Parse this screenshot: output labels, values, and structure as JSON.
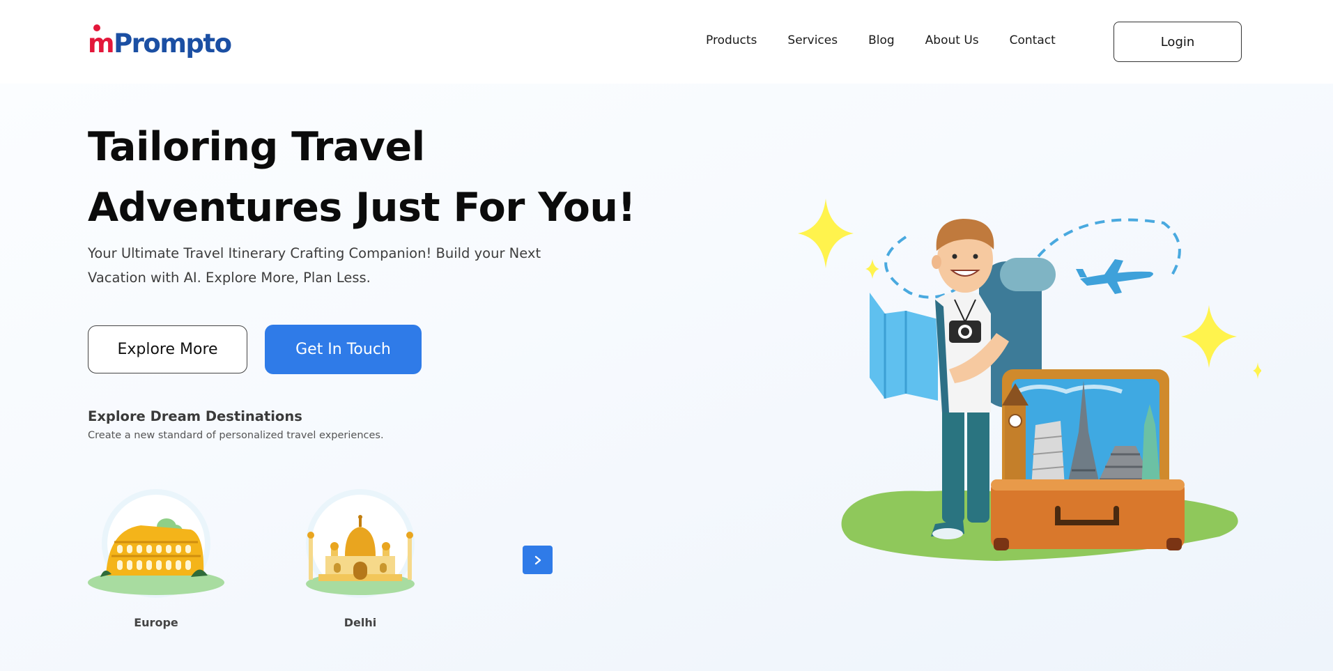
{
  "header": {
    "logo_m": "m",
    "logo_rest": "Prompto",
    "nav": [
      "Products",
      "Services",
      "Blog",
      "About Us",
      "Contact"
    ],
    "login_label": "Login"
  },
  "hero": {
    "title_line1": "Tailoring Travel",
    "title_line2": "Adventures Just For You!",
    "subtitle_line1": "Your Ultimate Travel Itinerary Crafting Companion! Build your Next",
    "subtitle_line2": "Vacation with AI. Explore More, Plan Less.",
    "explore_label": "Explore More",
    "touch_label": "Get In Touch"
  },
  "destinations": {
    "title": "Explore Dream Destinations",
    "subtitle": "Create a new standard of personalized travel experiences.",
    "items": [
      {
        "label": "Europe",
        "icon": "colosseum-icon"
      },
      {
        "label": "Delhi",
        "icon": "taj-mahal-icon"
      }
    ],
    "next_icon": "chevron-right-icon"
  },
  "colors": {
    "brand_red": "#e3173a",
    "brand_blue": "#1b4fa3",
    "primary_button": "#2f7be8"
  }
}
